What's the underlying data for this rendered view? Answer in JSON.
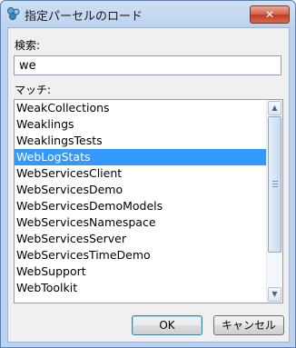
{
  "window": {
    "title": "指定パーセルのロード",
    "close_label": "✕"
  },
  "search": {
    "label": "検索:",
    "value": "we"
  },
  "matches": {
    "label": "マッチ:",
    "items": [
      "WeakCollections",
      "Weaklings",
      "WeaklingsTests",
      "WebLogStats",
      "WebServicesClient",
      "WebServicesDemo",
      "WebServicesDemoModels",
      "WebServicesNamespace",
      "WebServicesServer",
      "WebServicesTimeDemo",
      "WebSupport",
      "WebToolkit"
    ],
    "selected_index": 3
  },
  "buttons": {
    "ok": "OK",
    "cancel": "キャンセル"
  },
  "colors": {
    "selection": "#3399ff",
    "title_bar": "#bcd2ee",
    "close_button": "#c23b22"
  },
  "icons": {
    "app": "parcel-icon",
    "scroll_up": "chevron-up-icon",
    "scroll_down": "chevron-down-icon"
  }
}
